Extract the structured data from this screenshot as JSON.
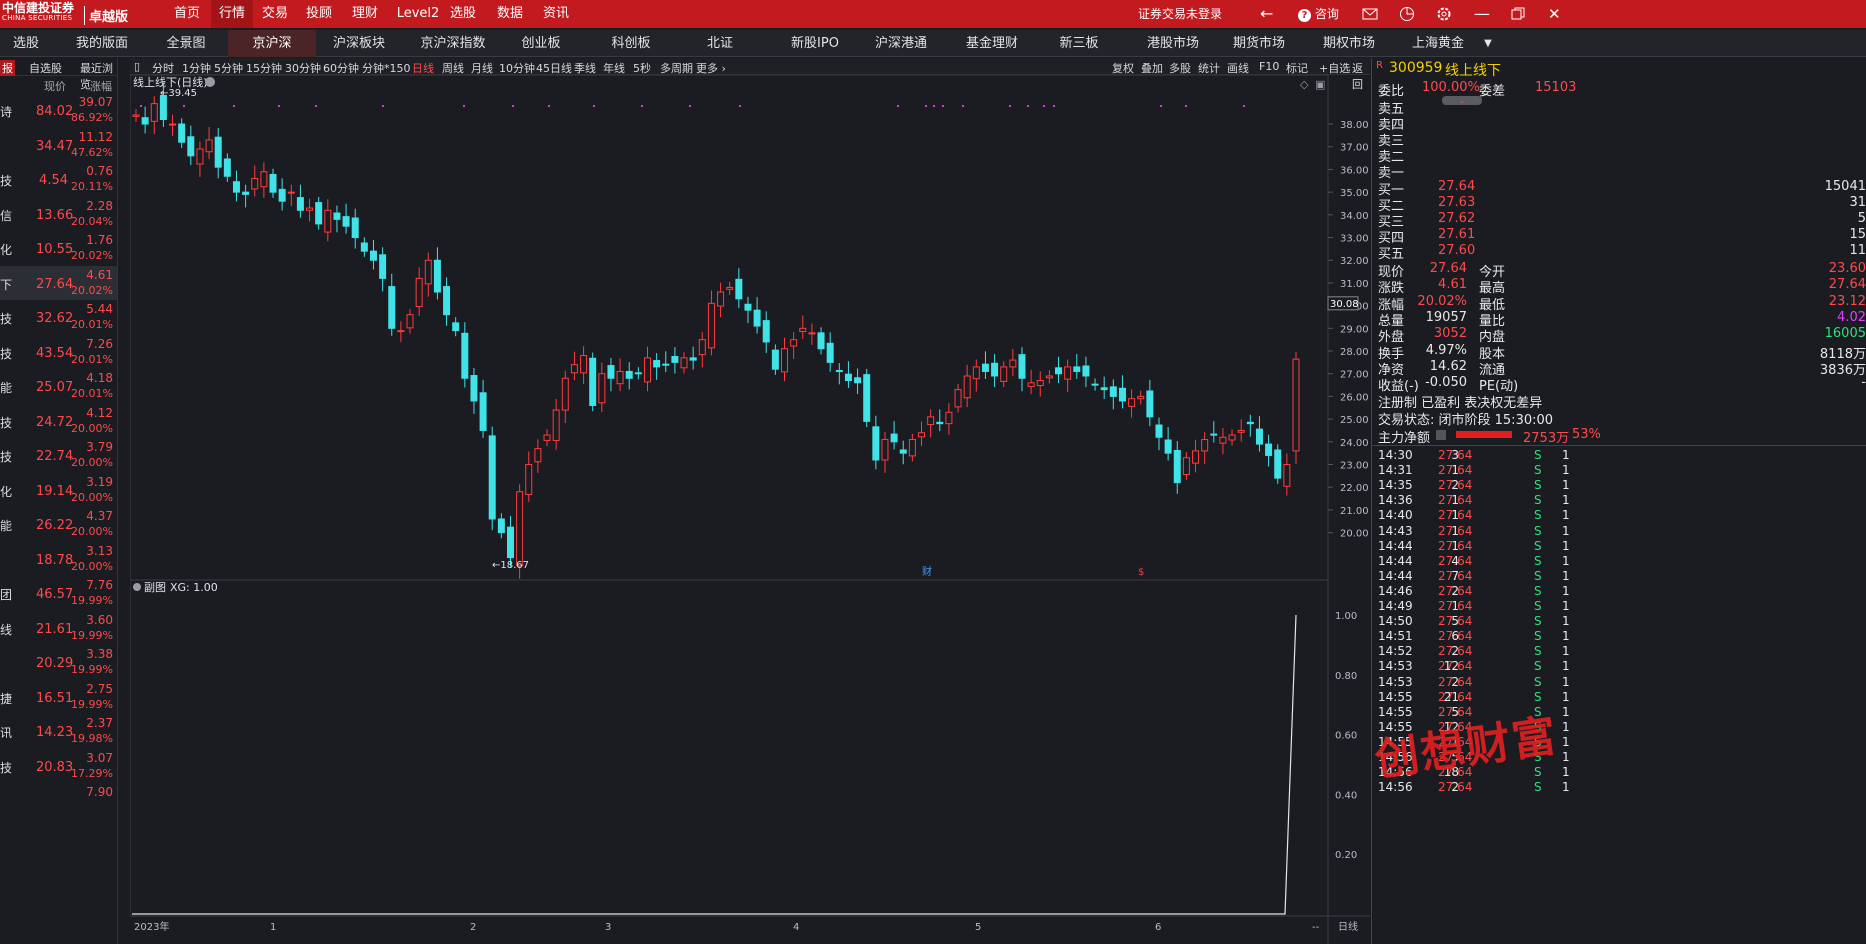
{
  "app": {
    "logo_cn": "中信建投证券",
    "logo_en": "CHINA SECURITIES",
    "edition": "卓越版"
  },
  "top_nav": [
    "首页",
    "行情",
    "交易",
    "投顾",
    "理财",
    "Level2",
    "选股",
    "数据",
    "资讯"
  ],
  "top_nav_active": 1,
  "top_right": {
    "login": "证券交易未登录",
    "consult": "咨询"
  },
  "second_nav": [
    "选股",
    "我的版面",
    "全景图",
    "京沪深",
    "沪深板块",
    "京沪深指数",
    "创业板",
    "科创板",
    "北证",
    "新股IPO",
    "沪深港通",
    "基金理财",
    "新三板",
    "港股市场",
    "期货市场",
    "期权市场",
    "上海黄金"
  ],
  "second_nav_active": 3,
  "left_tabs": [
    "报",
    "自选股",
    "最近浏览"
  ],
  "left_headers": [
    "现价",
    "涨幅"
  ],
  "left_rows": [
    {
      "n": "诗",
      "p": "84.02",
      "c": "39.07",
      "pc": "86.92%"
    },
    {
      "n": "",
      "p": "34.47",
      "c": "11.12",
      "pc": "47.62%"
    },
    {
      "n": "技",
      "p": "4.54",
      "c": "0.76",
      "pc": "20.11%"
    },
    {
      "n": "信",
      "p": "13.66",
      "c": "2.28",
      "pc": "20.04%"
    },
    {
      "n": "化",
      "p": "10.55",
      "c": "1.76",
      "pc": "20.02%"
    },
    {
      "n": "下",
      "p": "27.64",
      "c": "4.61",
      "pc": "20.02%"
    },
    {
      "n": "技",
      "p": "32.62",
      "c": "5.44",
      "pc": "20.01%"
    },
    {
      "n": "技",
      "p": "43.54",
      "c": "7.26",
      "pc": "20.01%"
    },
    {
      "n": "能",
      "p": "25.07",
      "c": "4.18",
      "pc": "20.01%"
    },
    {
      "n": "技",
      "p": "24.72",
      "c": "4.12",
      "pc": "20.00%"
    },
    {
      "n": "技",
      "p": "22.74",
      "c": "3.79",
      "pc": "20.00%"
    },
    {
      "n": "化",
      "p": "19.14",
      "c": "3.19",
      "pc": "20.00%"
    },
    {
      "n": "能",
      "p": "26.22",
      "c": "4.37",
      "pc": "20.00%"
    },
    {
      "n": "",
      "p": "18.78",
      "c": "3.13",
      "pc": "20.00%"
    },
    {
      "n": "团",
      "p": "46.57",
      "c": "7.76",
      "pc": "19.99%"
    },
    {
      "n": "线",
      "p": "21.61",
      "c": "3.60",
      "pc": "19.99%"
    },
    {
      "n": "",
      "p": "20.29",
      "c": "3.38",
      "pc": "19.99%"
    },
    {
      "n": "捷",
      "p": "16.51",
      "c": "2.75",
      "pc": "19.99%"
    },
    {
      "n": "讯",
      "p": "14.23",
      "c": "2.37",
      "pc": "19.98%"
    },
    {
      "n": "技",
      "p": "20.83",
      "c": "3.07",
      "pc": "17.29%"
    },
    {
      "n": "",
      "p": "",
      "c": "7.90",
      "pc": ""
    }
  ],
  "left_selected": 5,
  "chart_tools": [
    "分时",
    "1分钟",
    "5分钟",
    "15分钟",
    "30分钟",
    "60分钟",
    "分钟*150",
    "日线",
    "周线",
    "月线",
    "10分钟",
    "45日线",
    "季线",
    "年线",
    "5秒",
    "多周期",
    "更多"
  ],
  "chart_tools_active": 7,
  "chart_tools_right": [
    "复权",
    "叠加",
    "多股",
    "统计",
    "画线",
    "F10",
    "标记",
    "+自选",
    "返回"
  ],
  "chart_title": "线上线下(日线)",
  "sub_title": "副图",
  "sub_indicator": "XG: 1.00",
  "x_labels": [
    "2023年",
    "1",
    "2",
    "3",
    "4",
    "5",
    "6"
  ],
  "bottom_right_label": "日线",
  "markers": {
    "cai": "财",
    "s": "$"
  },
  "chart_data": {
    "type": "candlestick",
    "ylim": [
      18.0,
      39.5
    ],
    "yticks": [
      20,
      21,
      22,
      23,
      24,
      25,
      26,
      27,
      28,
      29,
      30,
      31,
      32,
      33,
      34,
      35,
      36,
      37,
      38
    ],
    "ylabels": [
      "20.00",
      "21.00",
      "22.00",
      "23.00",
      "24.00",
      "25.00",
      "26.00",
      "27.00",
      "28.00",
      "29.00",
      "30.00",
      "31.00",
      "32.00",
      "33.00",
      "34.00",
      "35.00",
      "36.00",
      "37.00",
      "38.00"
    ],
    "current_label": "30.08",
    "high_label": "39.45",
    "low_label": "18.67",
    "closes": [
      38.4,
      38.0,
      38.9,
      38.2,
      38.0,
      37.2,
      36.6,
      36.9,
      37.3,
      36.1,
      35.7,
      35.0,
      34.9,
      35.6,
      35.9,
      35.0,
      34.6,
      35.0,
      34.2,
      34.3,
      33.6,
      34.2,
      33.8,
      33.5,
      33.0,
      32.4,
      32.0,
      31.2,
      29.0,
      28.9,
      29.6,
      31.2,
      32.0,
      30.6,
      29.6,
      28.9,
      26.8,
      25.8,
      24.5,
      20.6,
      20.0,
      18.9,
      21.8,
      23.0,
      23.7,
      24.3,
      25.4,
      26.8,
      27.4,
      27.8,
      25.6,
      27.0,
      26.8,
      27.1,
      26.8,
      27.0,
      27.7,
      27.3,
      27.4,
      27.5,
      27.7,
      27.6,
      28.5,
      30.1,
      30.6,
      30.8,
      30.3,
      29.8,
      29.1,
      28.4,
      27.2,
      28.1,
      28.5,
      29.0,
      28.8,
      28.1,
      27.5,
      27.1,
      26.7,
      26.6,
      24.9,
      23.2,
      24.1,
      24.0,
      23.5,
      24.1,
      24.4,
      25.1,
      24.8,
      25.3,
      26.3,
      26.9,
      27.3,
      27.1,
      26.9,
      27.3,
      27.6,
      26.8,
      26.6,
      26.7,
      26.9,
      27.0,
      27.3,
      27.1,
      26.9,
      26.5,
      26.3,
      26.0,
      25.8,
      25.9,
      26.0,
      25.1,
      24.2,
      23.5,
      22.2,
      23.3,
      23.6,
      24.1,
      24.3,
      24.2,
      24.3,
      24.5,
      24.8,
      23.9,
      23.4,
      22.4,
      23.0,
      27.64
    ],
    "sub_values": {
      "type": "line",
      "last": 1.0,
      "ylim": [
        0,
        1.0
      ],
      "yticks": [
        "0.20",
        "0.40",
        "0.60",
        "0.80",
        "1.00"
      ]
    }
  },
  "quote": {
    "symbol": "300959",
    "name": "线上线下",
    "flag": "R",
    "weibi_label": "委比",
    "weibi": "100.00%",
    "weicha_label": "委差",
    "weicha": "15103",
    "sells": [
      {
        "l": "卖五"
      },
      {
        "l": "卖四"
      },
      {
        "l": "卖三"
      },
      {
        "l": "卖二"
      },
      {
        "l": "卖一"
      }
    ],
    "buys": [
      {
        "l": "买一",
        "p": "27.64",
        "v": "15041"
      },
      {
        "l": "买二",
        "p": "27.63",
        "v": "31"
      },
      {
        "l": "买三",
        "p": "27.62",
        "v": "5"
      },
      {
        "l": "买四",
        "p": "27.61",
        "v": "15"
      },
      {
        "l": "买五",
        "p": "27.60",
        "v": "11"
      }
    ],
    "stats": [
      {
        "l1": "现价",
        "v1": "27.64",
        "c1": "red",
        "l2": "今开",
        "v2": "23.60",
        "c2": "red"
      },
      {
        "l1": "涨跌",
        "v1": "4.61",
        "c1": "red",
        "l2": "最高",
        "v2": "27.64",
        "c2": "red"
      },
      {
        "l1": "涨幅",
        "v1": "20.02%",
        "c1": "red",
        "l2": "最低",
        "v2": "23.12",
        "c2": "red"
      },
      {
        "l1": "总量",
        "v1": "19057",
        "c1": "wht",
        "l2": "量比",
        "v2": "4.02",
        "c2": "mag"
      },
      {
        "l1": "外盘",
        "v1": "3052",
        "c1": "red",
        "l2": "内盘",
        "v2": "16005",
        "c2": "grn"
      },
      {
        "l1": "换手",
        "v1": "4.97%",
        "c1": "wht",
        "l2": "股本",
        "v2": "8118万",
        "c2": "wht"
      },
      {
        "l1": "净资",
        "v1": "14.62",
        "c1": "wht",
        "l2": "流通",
        "v2": "3836万",
        "c2": "wht"
      },
      {
        "l1": "收益(-)",
        "v1": "-0.050",
        "c1": "wht",
        "l2": "PE(动)",
        "v2": "-",
        "c2": "wht"
      }
    ],
    "tags": "注册制 已盈利 表决权无差异",
    "trade_status": "交易状态: 闭市阶段 15:30:00",
    "main_flow_label": "主力净额",
    "main_flow_val": "2753万",
    "main_flow_pct": "53%"
  },
  "ticks": [
    {
      "t": "14:30",
      "p": "27.64",
      "v": "3",
      "s": "S"
    },
    {
      "t": "14:31",
      "p": "27.64",
      "v": "1",
      "s": "S"
    },
    {
      "t": "14:35",
      "p": "27.64",
      "v": "2",
      "s": "S"
    },
    {
      "t": "14:36",
      "p": "27.64",
      "v": "1",
      "s": "S"
    },
    {
      "t": "14:40",
      "p": "27.64",
      "v": "1",
      "s": "S"
    },
    {
      "t": "14:43",
      "p": "27.64",
      "v": "1",
      "s": "S"
    },
    {
      "t": "14:44",
      "p": "27.64",
      "v": "1",
      "s": "S"
    },
    {
      "t": "14:44",
      "p": "27.64",
      "v": "4",
      "s": "S"
    },
    {
      "t": "14:44",
      "p": "27.64",
      "v": "7",
      "s": "S"
    },
    {
      "t": "14:46",
      "p": "27.64",
      "v": "2",
      "s": "S"
    },
    {
      "t": "14:49",
      "p": "27.64",
      "v": "1",
      "s": "S"
    },
    {
      "t": "14:50",
      "p": "27.64",
      "v": "5",
      "s": "S"
    },
    {
      "t": "14:51",
      "p": "27.64",
      "v": "6",
      "s": "S"
    },
    {
      "t": "14:52",
      "p": "27.64",
      "v": "2",
      "s": "S"
    },
    {
      "t": "14:53",
      "p": "27.64",
      "v": "12",
      "s": "S"
    },
    {
      "t": "14:53",
      "p": "27.64",
      "v": "2",
      "s": "S"
    },
    {
      "t": "14:55",
      "p": "27.64",
      "v": "21",
      "s": "S"
    },
    {
      "t": "14:55",
      "p": "27.64",
      "v": "5",
      "s": "S"
    },
    {
      "t": "14:55",
      "p": "27.64",
      "v": "12",
      "s": "S"
    },
    {
      "t": "14:55",
      "p": "27.64",
      "v": "1",
      "s": "S"
    },
    {
      "t": "14:56",
      "p": "27.64",
      "v": "5",
      "s": "S"
    },
    {
      "t": "14:56",
      "p": "27.64",
      "v": "18",
      "s": "S"
    },
    {
      "t": "14:56",
      "p": "27.64",
      "v": "2",
      "s": "S"
    }
  ],
  "watermark": "创想财富"
}
